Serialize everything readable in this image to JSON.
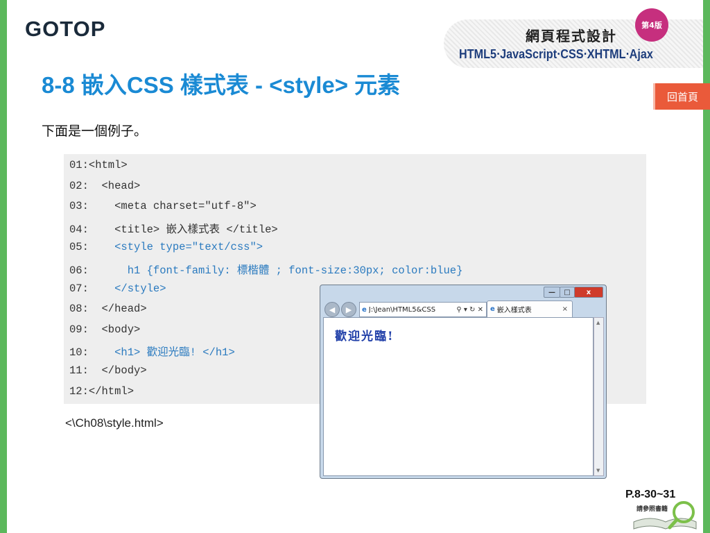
{
  "header": {
    "logo": "GOTOP",
    "book_title": "網頁程式設計",
    "edition": "第4版",
    "book_subtitle": "HTML5‧JavaScript‧CSS‧XHTML‧Ajax"
  },
  "slide": {
    "title": "8-8  嵌入CSS 樣式表 - <style> 元素",
    "home_button": "回首頁",
    "intro": "下面是一個例子。",
    "file_label": "<\\Ch08\\style.html>",
    "page_number": "P.8-30~31",
    "page_note": "請參照書籍"
  },
  "code": {
    "lines": [
      {
        "num": "01:",
        "pre": "<html>",
        "tag": ""
      },
      {
        "num": "02:",
        "pre": "  <head>",
        "tag": ""
      },
      {
        "num": "03:",
        "pre": "    <meta charset=\"utf-8\">",
        "tag": ""
      },
      {
        "num": "04:",
        "pre": "    <title> 嵌入樣式表 </title>",
        "tag": ""
      },
      {
        "num": "05:",
        "pre": "    ",
        "tag": "<style type=\"text/css\">"
      },
      {
        "num": "06:",
        "pre": "      ",
        "tag": "h1 {font-family: 標楷體 ; font-size:30px; color:blue}"
      },
      {
        "num": "07:",
        "pre": "    ",
        "tag": "</style>"
      },
      {
        "num": "08:",
        "pre": "  </head>",
        "tag": ""
      },
      {
        "num": "09:",
        "pre": "  <body>",
        "tag": ""
      },
      {
        "num": "10:",
        "pre": "    ",
        "tag": "<h1> 歡迎光臨! </h1>"
      },
      {
        "num": "11:",
        "pre": "  </body>",
        "tag": ""
      },
      {
        "num": "12:",
        "pre": "</html>",
        "tag": ""
      }
    ]
  },
  "browser": {
    "address": "J:\\Jean\\HTML5&CSS",
    "address_tools": "⚲ ▾ ↻ ✕",
    "tab_title": "嵌入樣式表",
    "tab_close": "×",
    "ie_icon": "e",
    "back": "◀",
    "forward": "▶",
    "min": "—",
    "max": "□",
    "close": "x",
    "page_heading": "歡迎光臨!",
    "scroll_up": "▲",
    "scroll_down": "▼"
  },
  "colors": {
    "title_blue": "#1a8ad4",
    "code_tag_blue": "#2a7abf",
    "home_button": "#ea5a3a",
    "side_bar": "#5cb85c"
  }
}
